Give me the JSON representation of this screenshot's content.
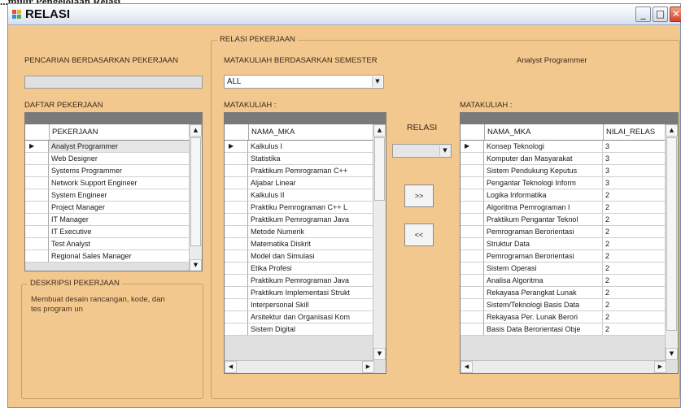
{
  "caption": "...mulir Pengelolaan Relasi",
  "window": {
    "title": "RELASI",
    "minimize_glyph": "_",
    "maximize_glyph": "□",
    "close_glyph": "✕"
  },
  "search": {
    "label": "PENCARIAN BERDASARKAN PEKERJAAN",
    "value": ""
  },
  "job_list": {
    "label": "DAFTAR PEKERJAAN",
    "column": "PEKERJAAN",
    "current_marker": "▶",
    "rows": [
      "Analyst Programmer",
      "Web Designer",
      "Systems Programmer",
      "Network Support Engineer",
      "System Engineer",
      "Project Manager",
      "IT Manager",
      "IT Executive",
      "Test Analyst",
      "Regional Sales Manager"
    ]
  },
  "description": {
    "legend": "DESKRIPSI PEKERJAAN",
    "text_line1": "Membuat desain rancangan, kode, dan",
    "text_line2": "tes program un"
  },
  "relation_group": {
    "legend": "RELASI PEKERJAAN",
    "semester_label": "MATAKULIAH BERDASARKAN SEMESTER",
    "semester_value": "ALL",
    "selected_job": "Analyst Programmer",
    "relasi_label": "RELASI",
    "relasi_value": "",
    "add_button": ">>",
    "remove_button": "<<"
  },
  "course_list": {
    "label": "MATAKULIAH :",
    "column": "NAMA_MKA",
    "current_marker": "▶",
    "rows": [
      "Kalkulus I",
      "Statistika",
      "Praktikum Pemrograman C++",
      "Aljabar Linear",
      "Kalkulus II",
      "Praktiku Pemrograman C++ L",
      "Praktikum Pemrograman Java",
      "Metode Numerik",
      "Matematika Diskrit",
      "Model dan Simulasi",
      "Etika Profesi",
      "Praktikum Pemrograman Java",
      "Praktikum Implementasi Strukt",
      "Interpersonal Skill",
      "Arsitektur dan Organisasi Kom",
      "Sistem Digital"
    ]
  },
  "relation_list": {
    "label": "MATAKULIAH :",
    "columns": [
      "NAMA_MKA",
      "NILAI_RELAS"
    ],
    "current_marker": "▶",
    "rows": [
      {
        "name": "Konsep Teknologi",
        "value": "3"
      },
      {
        "name": "Komputer dan Masyarakat",
        "value": "3"
      },
      {
        "name": "Sistem Pendukung Keputus",
        "value": "3"
      },
      {
        "name": "Pengantar Teknologi Inform",
        "value": "3"
      },
      {
        "name": "Logika Informatika",
        "value": "2"
      },
      {
        "name": "Algoritma Pemrograman I",
        "value": "2"
      },
      {
        "name": "Praktikum Pengantar Teknol",
        "value": "2"
      },
      {
        "name": "Pemrograman Berorientasi",
        "value": "2"
      },
      {
        "name": "Struktur Data",
        "value": "2"
      },
      {
        "name": "Pemrograman Berorientasi",
        "value": "2"
      },
      {
        "name": "Sistem Operasi",
        "value": "2"
      },
      {
        "name": "Analisa Algoritma",
        "value": "2"
      },
      {
        "name": "Rekayasa Perangkat Lunak",
        "value": "2"
      },
      {
        "name": "Sistem/Teknologi Basis Data",
        "value": "2"
      },
      {
        "name": "Rekayasa Per. Lunak Berori",
        "value": "2"
      },
      {
        "name": "Basis Data Berorientasi Obje",
        "value": "2"
      }
    ]
  },
  "icons": {
    "up": "▲",
    "down": "▼",
    "left": "◀",
    "right": "▶"
  },
  "colors": {
    "window_bg": "#f3c88e",
    "grid_bg": "#e0e0e0",
    "grid_topbar": "#7a7a7a"
  }
}
